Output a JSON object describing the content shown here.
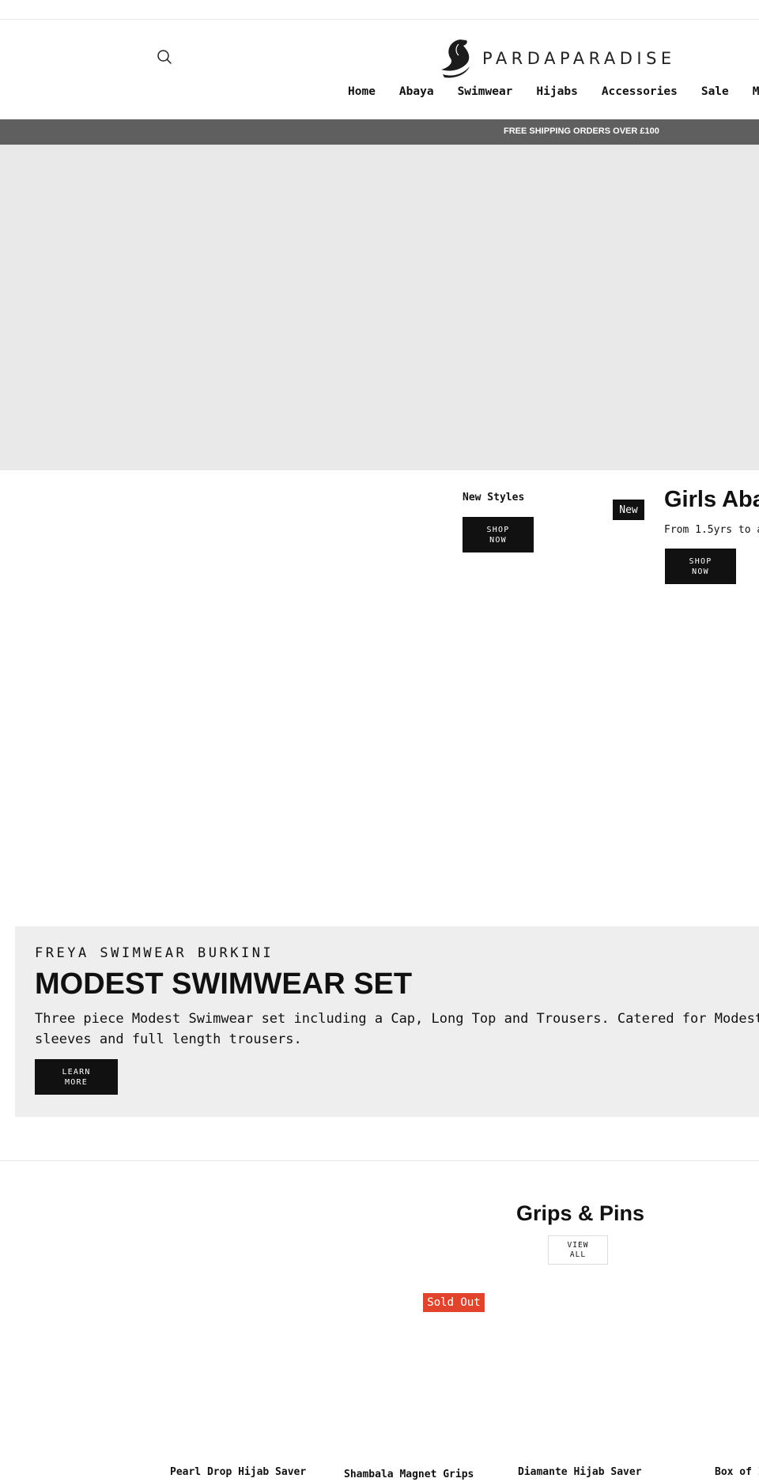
{
  "header": {
    "logo_text": "PARDAPARADISE",
    "nav": [
      {
        "label": "Home"
      },
      {
        "label": "Abaya"
      },
      {
        "label": "Swimwear"
      },
      {
        "label": "Hijabs"
      },
      {
        "label": "Accessories"
      },
      {
        "label": "Sale"
      },
      {
        "label": "Men"
      }
    ]
  },
  "announcement": "FREE SHIPPING ORDERS OVER £100",
  "promos": [
    {
      "heading": "New Styles",
      "button": "SHOP NOW",
      "badge": "New"
    },
    {
      "heading": "Girls Aba",
      "subtext": "From 1.5yrs to a",
      "button": "SHOP NOW"
    }
  ],
  "feature": {
    "eyebrow": "FREYA SWIMWEAR BURKINI",
    "title": "MODEST SWIMWEAR SET",
    "body": "Three piece Modest Swimwear set including a Cap, Long Top and Trousers. Catered for Modesty an sleeves and full length trousers.",
    "button": "LEARN MORE"
  },
  "collection": {
    "title": "Grips & Pins",
    "view_all": "VIEW ALL",
    "sold_out_badge": "Sold Out",
    "products": [
      {
        "name": "Pearl Drop Hijab Saver"
      },
      {
        "name": "Shambala Magnet Grips"
      },
      {
        "name": "Diamante Hijab Saver"
      },
      {
        "name": "Box of I"
      }
    ]
  }
}
